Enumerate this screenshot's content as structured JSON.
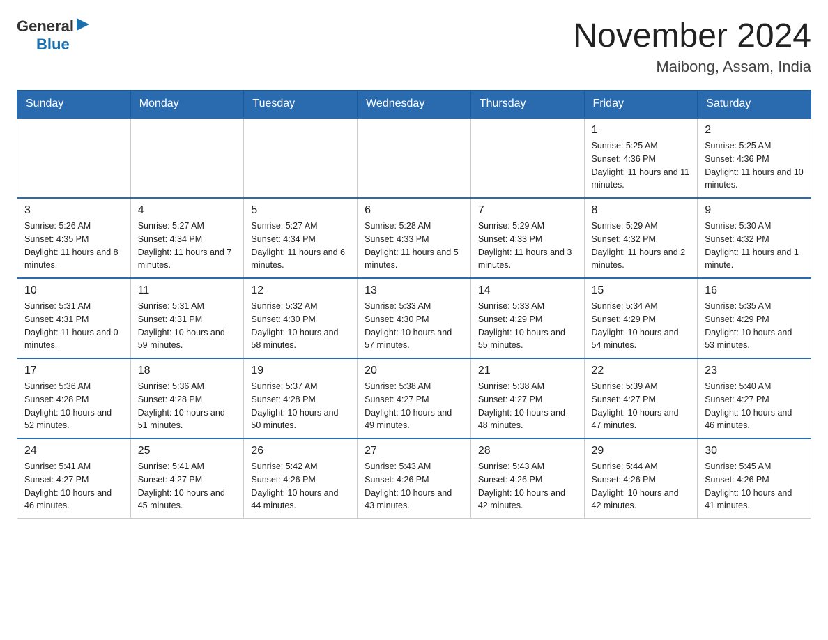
{
  "logo": {
    "general": "General",
    "blue": "Blue"
  },
  "header": {
    "month_year": "November 2024",
    "location": "Maibong, Assam, India"
  },
  "days_of_week": [
    "Sunday",
    "Monday",
    "Tuesday",
    "Wednesday",
    "Thursday",
    "Friday",
    "Saturday"
  ],
  "weeks": [
    [
      {
        "day": "",
        "info": ""
      },
      {
        "day": "",
        "info": ""
      },
      {
        "day": "",
        "info": ""
      },
      {
        "day": "",
        "info": ""
      },
      {
        "day": "",
        "info": ""
      },
      {
        "day": "1",
        "info": "Sunrise: 5:25 AM\nSunset: 4:36 PM\nDaylight: 11 hours and 11 minutes."
      },
      {
        "day": "2",
        "info": "Sunrise: 5:25 AM\nSunset: 4:36 PM\nDaylight: 11 hours and 10 minutes."
      }
    ],
    [
      {
        "day": "3",
        "info": "Sunrise: 5:26 AM\nSunset: 4:35 PM\nDaylight: 11 hours and 8 minutes."
      },
      {
        "day": "4",
        "info": "Sunrise: 5:27 AM\nSunset: 4:34 PM\nDaylight: 11 hours and 7 minutes."
      },
      {
        "day": "5",
        "info": "Sunrise: 5:27 AM\nSunset: 4:34 PM\nDaylight: 11 hours and 6 minutes."
      },
      {
        "day": "6",
        "info": "Sunrise: 5:28 AM\nSunset: 4:33 PM\nDaylight: 11 hours and 5 minutes."
      },
      {
        "day": "7",
        "info": "Sunrise: 5:29 AM\nSunset: 4:33 PM\nDaylight: 11 hours and 3 minutes."
      },
      {
        "day": "8",
        "info": "Sunrise: 5:29 AM\nSunset: 4:32 PM\nDaylight: 11 hours and 2 minutes."
      },
      {
        "day": "9",
        "info": "Sunrise: 5:30 AM\nSunset: 4:32 PM\nDaylight: 11 hours and 1 minute."
      }
    ],
    [
      {
        "day": "10",
        "info": "Sunrise: 5:31 AM\nSunset: 4:31 PM\nDaylight: 11 hours and 0 minutes."
      },
      {
        "day": "11",
        "info": "Sunrise: 5:31 AM\nSunset: 4:31 PM\nDaylight: 10 hours and 59 minutes."
      },
      {
        "day": "12",
        "info": "Sunrise: 5:32 AM\nSunset: 4:30 PM\nDaylight: 10 hours and 58 minutes."
      },
      {
        "day": "13",
        "info": "Sunrise: 5:33 AM\nSunset: 4:30 PM\nDaylight: 10 hours and 57 minutes."
      },
      {
        "day": "14",
        "info": "Sunrise: 5:33 AM\nSunset: 4:29 PM\nDaylight: 10 hours and 55 minutes."
      },
      {
        "day": "15",
        "info": "Sunrise: 5:34 AM\nSunset: 4:29 PM\nDaylight: 10 hours and 54 minutes."
      },
      {
        "day": "16",
        "info": "Sunrise: 5:35 AM\nSunset: 4:29 PM\nDaylight: 10 hours and 53 minutes."
      }
    ],
    [
      {
        "day": "17",
        "info": "Sunrise: 5:36 AM\nSunset: 4:28 PM\nDaylight: 10 hours and 52 minutes."
      },
      {
        "day": "18",
        "info": "Sunrise: 5:36 AM\nSunset: 4:28 PM\nDaylight: 10 hours and 51 minutes."
      },
      {
        "day": "19",
        "info": "Sunrise: 5:37 AM\nSunset: 4:28 PM\nDaylight: 10 hours and 50 minutes."
      },
      {
        "day": "20",
        "info": "Sunrise: 5:38 AM\nSunset: 4:27 PM\nDaylight: 10 hours and 49 minutes."
      },
      {
        "day": "21",
        "info": "Sunrise: 5:38 AM\nSunset: 4:27 PM\nDaylight: 10 hours and 48 minutes."
      },
      {
        "day": "22",
        "info": "Sunrise: 5:39 AM\nSunset: 4:27 PM\nDaylight: 10 hours and 47 minutes."
      },
      {
        "day": "23",
        "info": "Sunrise: 5:40 AM\nSunset: 4:27 PM\nDaylight: 10 hours and 46 minutes."
      }
    ],
    [
      {
        "day": "24",
        "info": "Sunrise: 5:41 AM\nSunset: 4:27 PM\nDaylight: 10 hours and 46 minutes."
      },
      {
        "day": "25",
        "info": "Sunrise: 5:41 AM\nSunset: 4:27 PM\nDaylight: 10 hours and 45 minutes."
      },
      {
        "day": "26",
        "info": "Sunrise: 5:42 AM\nSunset: 4:26 PM\nDaylight: 10 hours and 44 minutes."
      },
      {
        "day": "27",
        "info": "Sunrise: 5:43 AM\nSunset: 4:26 PM\nDaylight: 10 hours and 43 minutes."
      },
      {
        "day": "28",
        "info": "Sunrise: 5:43 AM\nSunset: 4:26 PM\nDaylight: 10 hours and 42 minutes."
      },
      {
        "day": "29",
        "info": "Sunrise: 5:44 AM\nSunset: 4:26 PM\nDaylight: 10 hours and 42 minutes."
      },
      {
        "day": "30",
        "info": "Sunrise: 5:45 AM\nSunset: 4:26 PM\nDaylight: 10 hours and 41 minutes."
      }
    ]
  ]
}
